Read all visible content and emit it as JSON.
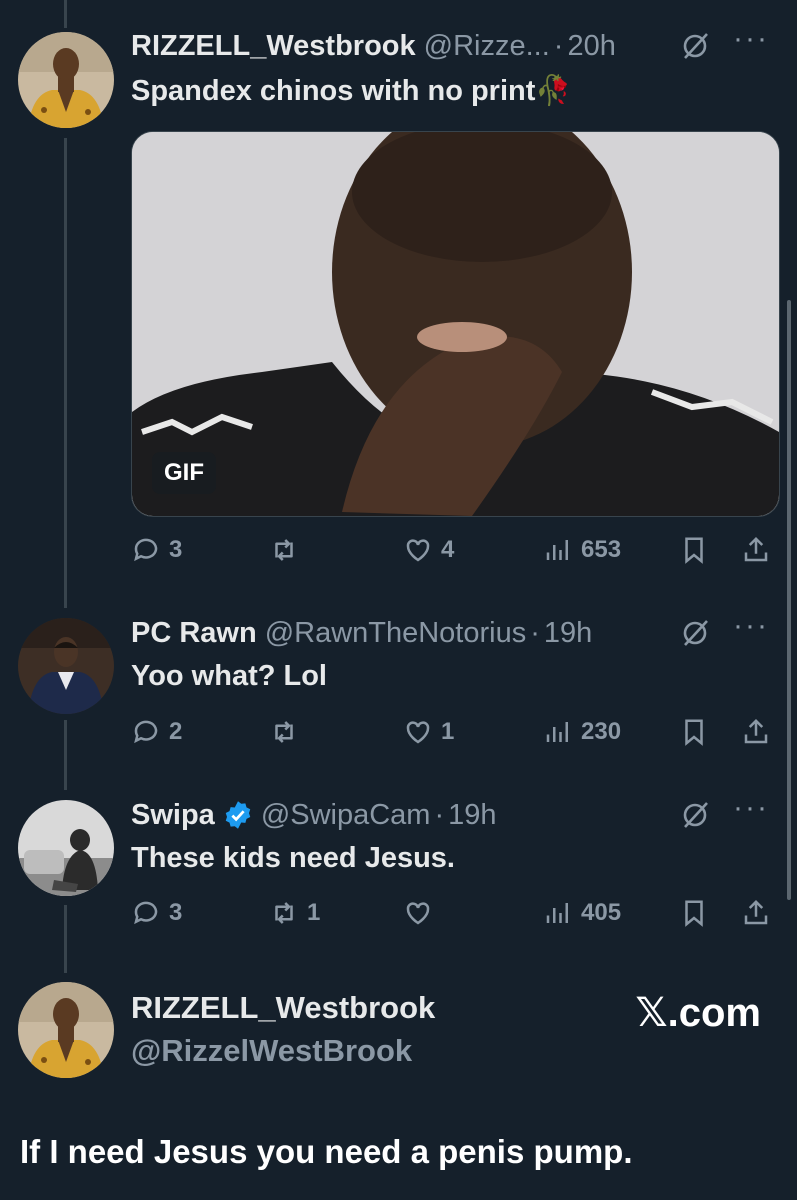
{
  "tweets": [
    {
      "display_name": "RIZZELL_Westbrook",
      "handle": "@Rizze...",
      "time": "20h",
      "text": "Spandex chinos with no print",
      "emoji": "🥀",
      "media": {
        "type": "gif",
        "badge": "GIF"
      },
      "actions": {
        "replies": "3",
        "reposts": "",
        "likes": "4",
        "views": "653"
      }
    },
    {
      "display_name": "PC Rawn",
      "handle": "@RawnTheNotorius",
      "time": "19h",
      "text": "Yoo what? Lol",
      "actions": {
        "replies": "2",
        "reposts": "",
        "likes": "1",
        "views": "230"
      }
    },
    {
      "display_name": "Swipa",
      "verified": true,
      "handle": "@SwipaCam",
      "time": "19h",
      "text": "These kids need Jesus.",
      "actions": {
        "replies": "3",
        "reposts": "1",
        "likes": "",
        "views": "405"
      }
    }
  ],
  "reply_card": {
    "display_name": "RIZZELL_Westbrook",
    "handle": "@RizzelWestBrook",
    "brand_x": "𝕏",
    "brand_suffix": ".com",
    "text": "If I need Jesus you need a penis pump."
  },
  "separator": "·",
  "more_glyph": "···",
  "icons": [
    "reply-icon",
    "repost-icon",
    "like-icon",
    "views-icon",
    "bookmark-icon",
    "share-icon",
    "grok-icon",
    "more-icon",
    "verified-icon"
  ],
  "colors": {
    "background": "#15202b",
    "text": "#e7e9ea",
    "muted": "#8b98a5",
    "verified": "#1d9bf0",
    "thread_line": "#38444d"
  }
}
